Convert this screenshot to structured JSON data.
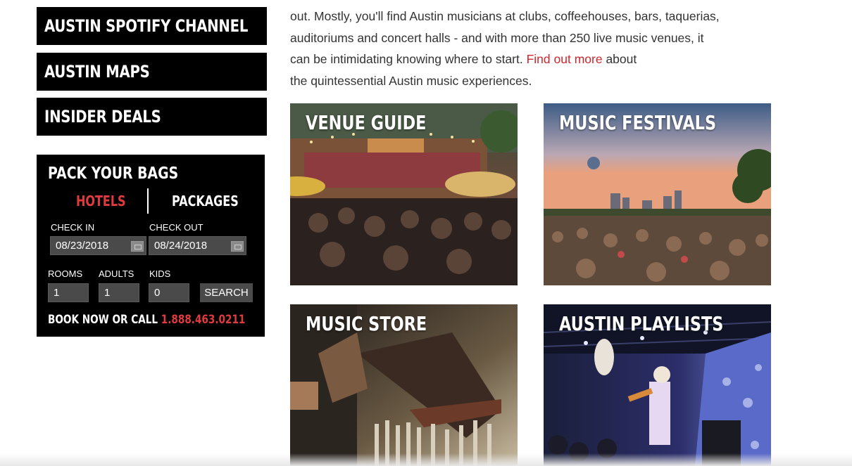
{
  "sidebar": {
    "nav": [
      {
        "label": "AUSTIN SPOTIFY CHANNEL"
      },
      {
        "label": "AUSTIN MAPS"
      },
      {
        "label": "INSIDER DEALS"
      }
    ]
  },
  "booking": {
    "title": "PACK YOUR BAGS",
    "tabs": {
      "hotels": "HOTELS",
      "packages": "PACKAGES",
      "active": "HOTELS"
    },
    "check_in": {
      "label": "CHECK IN",
      "value": "08/23/2018"
    },
    "check_out": {
      "label": "CHECK OUT",
      "value": "08/24/2018"
    },
    "rooms": {
      "label": "ROOMS",
      "value": "1"
    },
    "adults": {
      "label": "ADULTS",
      "value": "1"
    },
    "kids": {
      "label": "KIDS",
      "value": "0"
    },
    "search_label": "SEARCH",
    "book_text": "BOOK NOW OR CALL",
    "phone": "1.888.463.0211"
  },
  "intro": {
    "line1": "out. Mostly, you'll find Austin musicians at clubs, coffeehouses, bars, taquerias,",
    "line2": "auditoriums and concert halls - and with more than 250 live music venues, it",
    "line3_before": "can be intimidating knowing where to start.",
    "link": "Find out more",
    "line3_after": "about",
    "line4": "the quintessential Austin music experiences."
  },
  "tiles": [
    {
      "title": "VENUE GUIDE"
    },
    {
      "title": "MUSIC FESTIVALS"
    },
    {
      "title": "MUSIC STORE"
    },
    {
      "title": "AUSTIN PLAYLISTS"
    }
  ],
  "colors": {
    "accent": "#e03a3e",
    "link": "#d3262e",
    "panel": "#000000"
  }
}
